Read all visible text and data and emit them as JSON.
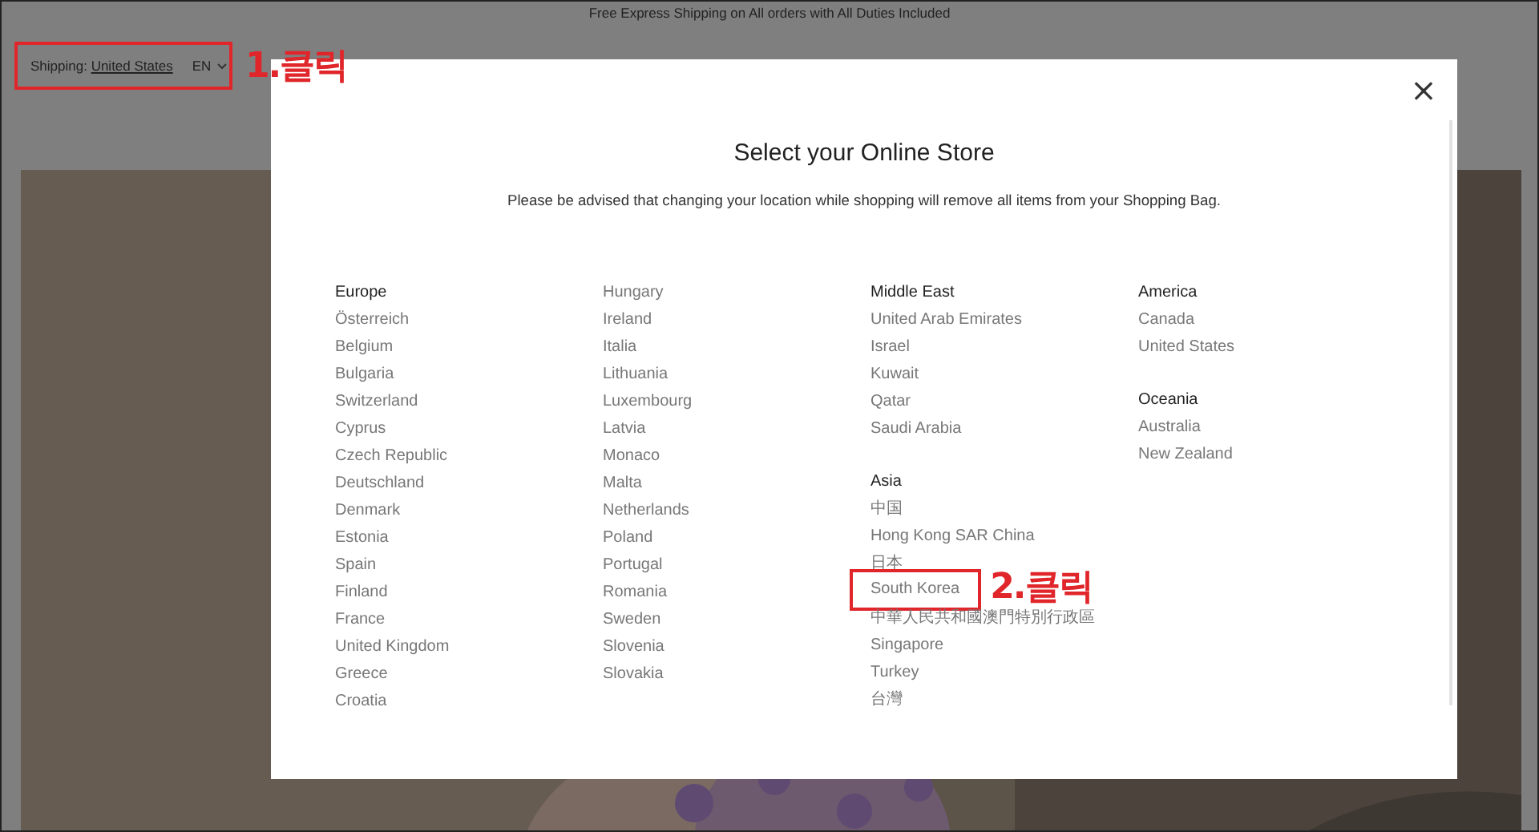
{
  "announcement": "Free Express Shipping on All orders with All Duties Included",
  "header": {
    "shipping_label": "Shipping:",
    "shipping_country": "United States",
    "language": "EN",
    "annotation": "1.클릭"
  },
  "modal": {
    "title": "Select your Online Store",
    "notice": "Please be advised that changing your location while shopping will remove all items from your Shopping Bag.",
    "close": "×",
    "columns": [
      {
        "groups": [
          {
            "heading": "Europe",
            "items": [
              {
                "label": "Österreich"
              },
              {
                "label": "Belgium"
              },
              {
                "label": "Bulgaria"
              },
              {
                "label": "Switzerland"
              },
              {
                "label": "Cyprus"
              },
              {
                "label": "Czech Republic"
              },
              {
                "label": "Deutschland"
              },
              {
                "label": "Denmark"
              },
              {
                "label": "Estonia"
              },
              {
                "label": "Spain"
              },
              {
                "label": "Finland"
              },
              {
                "label": "France"
              },
              {
                "label": "United Kingdom"
              },
              {
                "label": "Greece"
              },
              {
                "label": "Croatia"
              }
            ]
          }
        ]
      },
      {
        "groups": [
          {
            "items": [
              {
                "label": "Hungary"
              },
              {
                "label": "Ireland"
              },
              {
                "label": "Italia"
              },
              {
                "label": "Lithuania"
              },
              {
                "label": "Luxembourg"
              },
              {
                "label": "Latvia"
              },
              {
                "label": "Monaco"
              },
              {
                "label": "Malta"
              },
              {
                "label": "Netherlands"
              },
              {
                "label": "Poland"
              },
              {
                "label": "Portugal"
              },
              {
                "label": "Romania"
              },
              {
                "label": "Sweden"
              },
              {
                "label": "Slovenia"
              },
              {
                "label": "Slovakia"
              }
            ]
          }
        ]
      },
      {
        "groups": [
          {
            "heading": "Middle East",
            "items": [
              {
                "label": "United Arab Emirates"
              },
              {
                "label": "Israel"
              },
              {
                "label": "Kuwait"
              },
              {
                "label": "Qatar"
              },
              {
                "label": "Saudi Arabia"
              }
            ]
          },
          {
            "heading": "Asia",
            "items": [
              {
                "label": "中国"
              },
              {
                "label": "Hong Kong SAR China"
              },
              {
                "label": "日本"
              },
              {
                "label": "South Korea",
                "annotation": "2.클릭"
              },
              {
                "label": "中華人民共和國澳門特別行政區"
              },
              {
                "label": "Singapore"
              },
              {
                "label": "Turkey"
              },
              {
                "label": "台灣"
              }
            ]
          }
        ]
      },
      {
        "groups": [
          {
            "heading": "America",
            "items": [
              {
                "label": "Canada"
              },
              {
                "label": "United States"
              }
            ]
          },
          {
            "heading": "Oceania",
            "items": [
              {
                "label": "Australia"
              },
              {
                "label": "New Zealand"
              }
            ]
          }
        ]
      }
    ]
  }
}
